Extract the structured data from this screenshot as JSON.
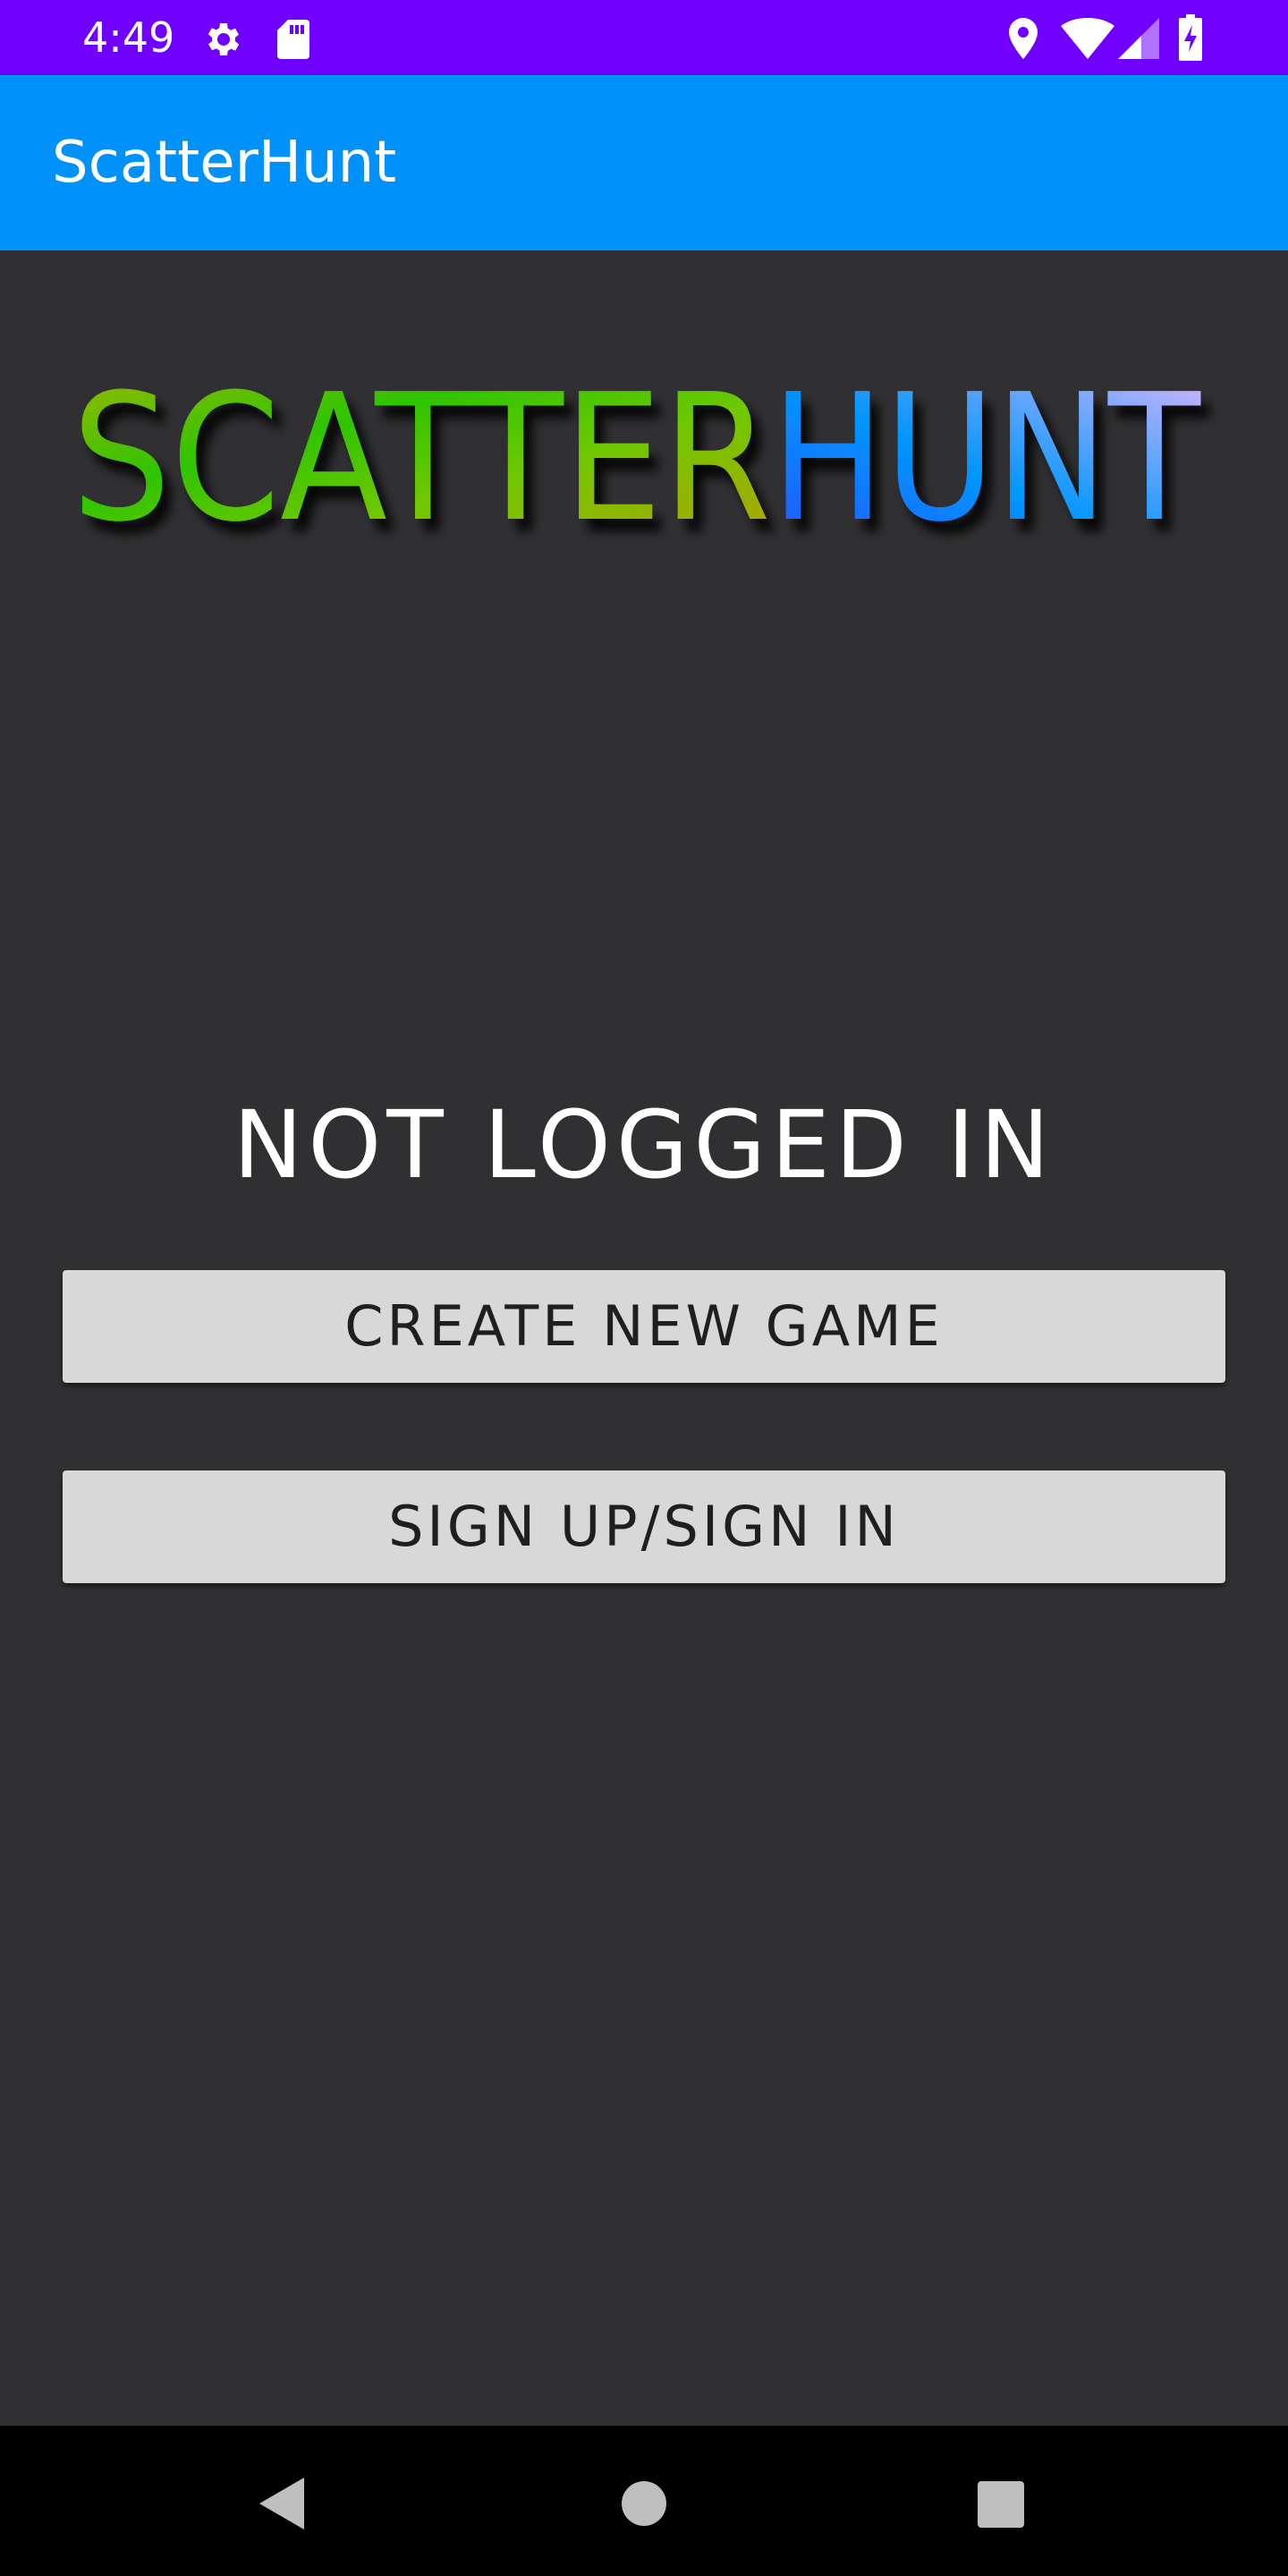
{
  "status_bar": {
    "time": "4:49",
    "icons": [
      "gear-icon",
      "sd-card-icon",
      "location-icon",
      "wifi-icon",
      "signal-icon",
      "battery-charging-icon"
    ],
    "background": "#7000ff"
  },
  "app_bar": {
    "title": "ScatterHunt",
    "background": "#0091fa"
  },
  "logo": {
    "text_part1": "SCATTER",
    "text_part2": "HUNT",
    "colors": {
      "part1_start": "#a3b800",
      "part1_mid": "#2ec400",
      "part1_end": "#b8a000",
      "part2_start": "#2a4dff",
      "part2_mid": "#0096ff",
      "part2_end": "#d8a8ff"
    }
  },
  "main": {
    "login_status": "NOT LOGGED IN",
    "create_game_label": "CREATE NEW GAME",
    "sign_in_label": "SIGN UP/SIGN IN",
    "background": "#303033",
    "button_color": "#d7d8d7"
  },
  "nav_bar": {
    "buttons": [
      "back-triangle-icon",
      "home-circle-icon",
      "recents-square-icon"
    ]
  }
}
